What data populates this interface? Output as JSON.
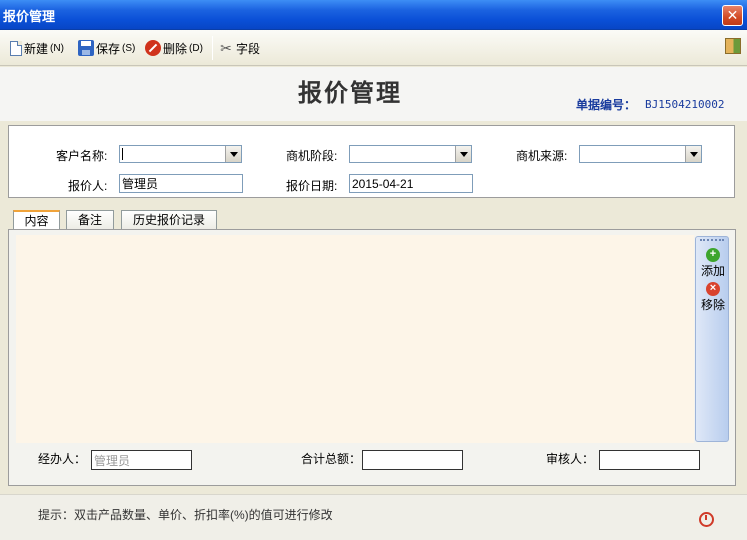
{
  "window": {
    "title": "报价管理",
    "close": "✕"
  },
  "toolbar": {
    "new_label": "新建",
    "new_key": "(N)",
    "save_label": "保存",
    "save_key": "(S)",
    "delete_label": "删除",
    "delete_key": "(D)",
    "field_label": "字段"
  },
  "header": {
    "title": "报价管理",
    "doc_no_label": "单据编号：",
    "doc_no_value": "BJ1504210002"
  },
  "form": {
    "customer_label": "客户名称:",
    "customer_value": "",
    "stage_label": "商机阶段:",
    "stage_value": "",
    "source_label": "商机来源:",
    "source_value": "",
    "quoter_label": "报价人:",
    "quoter_value": "管理员",
    "date_label": "报价日期:",
    "date_value": "2015-04-21"
  },
  "tabs": [
    {
      "label": "内容",
      "active": true
    },
    {
      "label": "备注",
      "active": false
    },
    {
      "label": "历史报价记录",
      "active": false
    }
  ],
  "side_actions": {
    "add_label": "添加",
    "remove_label": "移除"
  },
  "footer": {
    "handler_label": "经办人：",
    "handler_value": "管理员",
    "total_label": "合计总额：",
    "total_value": "",
    "reviewer_label": "审核人：",
    "reviewer_value": ""
  },
  "hint": "提示：双击产品数量、单价、折扣率(%)的值可进行修改",
  "icons": [
    "new-file-icon",
    "save-icon",
    "delete-icon",
    "field-icon",
    "exit-icon",
    "add-icon",
    "remove-icon",
    "clock-icon"
  ]
}
